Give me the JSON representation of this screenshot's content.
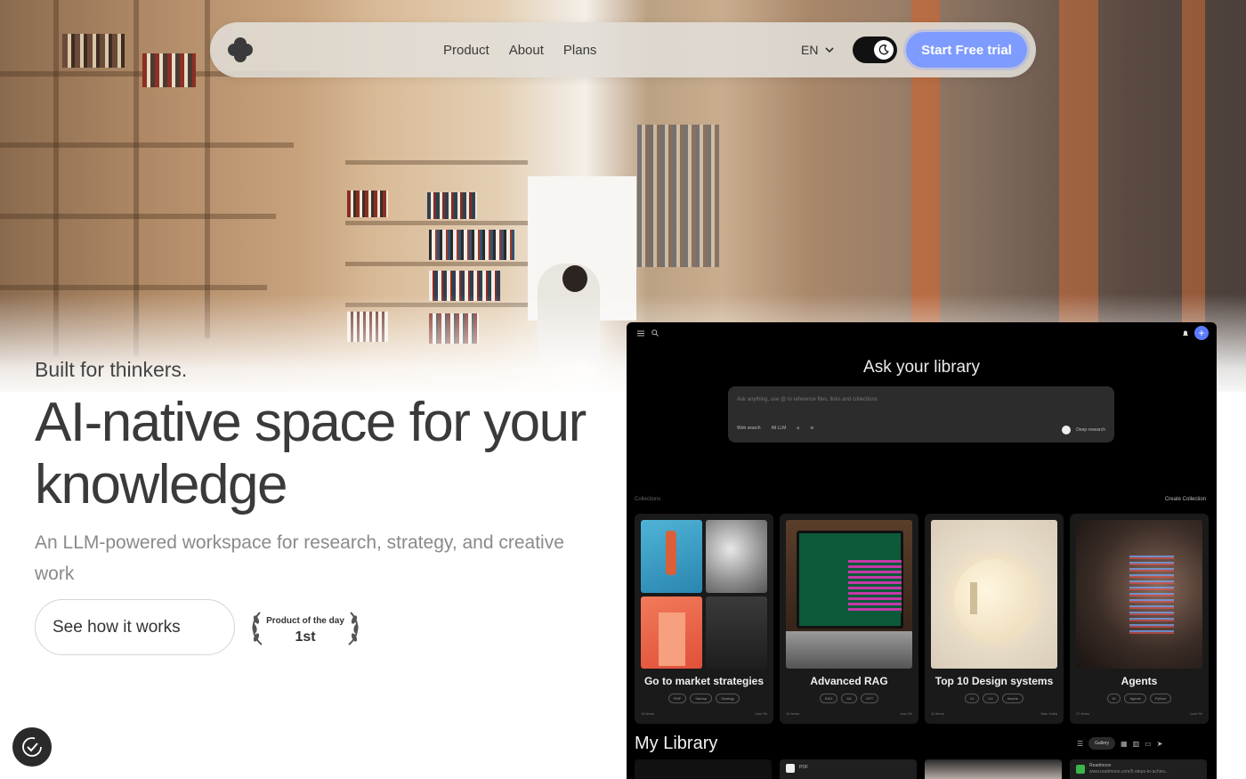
{
  "nav": {
    "links": [
      "Product",
      "About",
      "Plans"
    ],
    "language": "EN",
    "cta": "Start Free trial"
  },
  "hero": {
    "tagline": "Built for thinkers.",
    "headline": "AI-native space for your knowledge",
    "subheadline": "An LLM-powered workspace for research, strategy, and creative work",
    "secondary_button": "See how it works",
    "badge": {
      "label": "Product of the day",
      "rank": "1st"
    }
  },
  "app": {
    "title": "Ask your library",
    "search_placeholder": "Ask anything, use @ to reference files, links and collections",
    "search_tools": [
      "Web search",
      "All LLM"
    ],
    "deep_research": "Deep research",
    "collections_label": "Collections",
    "create_collection": "Create Collection",
    "collections": [
      {
        "title": "Go to market strategies",
        "tags": [
          "PMF",
          "Startup",
          "Strategy"
        ],
        "items": "14 items",
        "owner": "Ivan Sh"
      },
      {
        "title": "Advanced RAG",
        "tags": [
          "RAG",
          "ML",
          "GPT"
        ],
        "items": "10 items",
        "owner": "Ivan Sh"
      },
      {
        "title": "Top 10 Design systems",
        "tags": [
          "UI",
          "UX",
          "Assets"
        ],
        "items": "11 items",
        "owner": "Max Volka"
      },
      {
        "title": "Agents",
        "tags": [
          "AI",
          "Agents",
          "Python"
        ],
        "items": "27 items",
        "owner": "Ivan Sh"
      }
    ],
    "my_library": "My Library",
    "view_chip": "Gallery",
    "library_items": [
      "PDF",
      "Readmoon",
      "www.readmoon.com/5-steps-to-achiev..."
    ]
  },
  "colors": {
    "accent": "#7e9bff",
    "dark": "#000000",
    "headline": "#3a3a3a",
    "subhead": "#8a8a8a"
  }
}
